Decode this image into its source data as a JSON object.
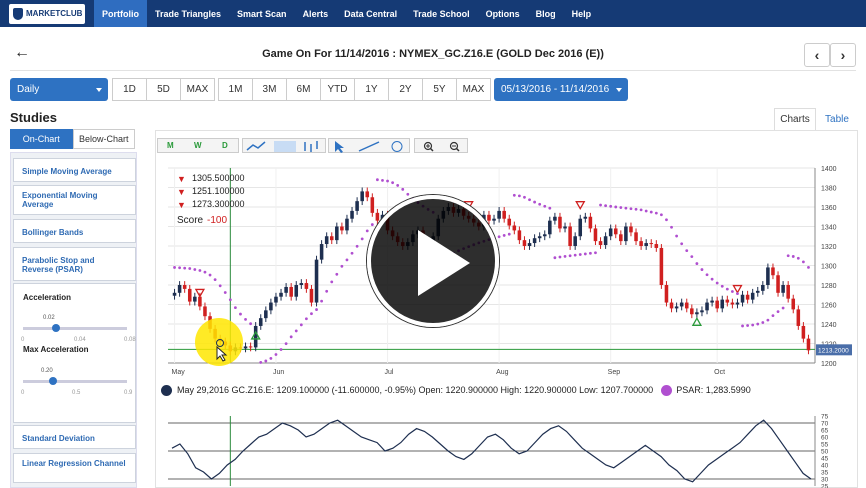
{
  "nav": {
    "logo": "MARKETCLUB",
    "items": [
      "Portfolio",
      "Trade Triangles",
      "Smart Scan",
      "Alerts",
      "Data Central",
      "Trade School",
      "Options",
      "Blog",
      "Help"
    ]
  },
  "header": {
    "back": "←",
    "title": "Game On For 11/14/2016 : NYMEX_GC.Z16.E (GOLD Dec 2016 (E))",
    "prev": "‹",
    "next": "›"
  },
  "range": {
    "interval": "Daily",
    "buttons": [
      "1D",
      "5D",
      "MAX",
      "1M",
      "3M",
      "6M",
      "YTD",
      "1Y",
      "2Y",
      "5Y",
      "MAX"
    ],
    "dates": "05/13/2016 - 11/14/2016"
  },
  "studies": {
    "heading": "Studies",
    "tabs": [
      "On-Chart",
      "Below-Chart"
    ],
    "list": [
      "Simple Moving Average",
      "Exponential Moving Average",
      "Bollinger Bands",
      "Parabolic Stop and Reverse (PSAR)",
      "Standard Deviation",
      "Linear Regression Channel"
    ],
    "psar": {
      "acceleration_label": "Acceleration",
      "acceleration_value": "0.02",
      "acceleration_ticks": [
        "0",
        "0.04",
        "0.08"
      ],
      "max_label": "Max Acceleration",
      "max_value": "0.20",
      "max_ticks": [
        "0",
        "0.5",
        "0.9"
      ]
    }
  },
  "view_tabs": [
    "Charts",
    "Table"
  ],
  "toolbar_icons": [
    "M",
    "W",
    "D"
  ],
  "legend": {
    "t1": "1305.500000",
    "t2": "1251.100000",
    "t3": "1273.300000",
    "score_label": "Score",
    "score_value": "-100"
  },
  "status_line": "May 29,2016 GC.Z16.E: 1209.100000 (-11.600000, -0.95%) Open: 1220.900000 High: 1220.900000 Low: 1207.700000",
  "psar_line": "PSAR: 1,283.5990",
  "colors": {
    "nav": "#153a75",
    "accent": "#2e72c2",
    "up": "#1e2f50",
    "down": "#d02020",
    "psar": "#b04fd0"
  },
  "chart_data": {
    "type": "candlestick",
    "x_ticks": [
      "May",
      "Jun",
      "Jul",
      "Aug",
      "Sep",
      "Oct"
    ],
    "y_ticks": [
      1200,
      1220,
      1240,
      1260,
      1280,
      1300,
      1320,
      1340,
      1360,
      1380,
      1400
    ],
    "ylim": [
      1200,
      1400
    ],
    "current_price_label": "1213.2000",
    "close": [
      1272,
      1280,
      1276,
      1263,
      1268,
      1258,
      1248,
      1235,
      1225,
      1222,
      1218,
      1212,
      1216,
      1215,
      1217,
      1216,
      1238,
      1246,
      1254,
      1262,
      1268,
      1272,
      1278,
      1268,
      1280,
      1282,
      1276,
      1262,
      1306,
      1322,
      1330,
      1326,
      1340,
      1336,
      1348,
      1356,
      1366,
      1376,
      1370,
      1354,
      1346,
      1352,
      1336,
      1330,
      1324,
      1320,
      1324,
      1332,
      1336,
      1326,
      1322,
      1330,
      1348,
      1356,
      1360,
      1354,
      1358,
      1351,
      1348,
      1344,
      1340,
      1352,
      1346,
      1348,
      1356,
      1348,
      1341,
      1336,
      1326,
      1320,
      1323,
      1328,
      1330,
      1332,
      1346,
      1350,
      1338,
      1340,
      1320,
      1330,
      1348,
      1350,
      1338,
      1325,
      1321,
      1330,
      1338,
      1332,
      1325,
      1340,
      1334,
      1325,
      1320,
      1323,
      1322,
      1318,
      1280,
      1262,
      1256,
      1258,
      1262,
      1256,
      1250,
      1252,
      1254,
      1262,
      1264,
      1256,
      1265,
      1262,
      1260,
      1262,
      1270,
      1265,
      1272,
      1274,
      1280,
      1298,
      1290,
      1272,
      1280,
      1266,
      1255,
      1238,
      1225,
      1213
    ],
    "oscillator": {
      "y_ticks": [
        25,
        30,
        35,
        40,
        45,
        50,
        55,
        60,
        65,
        70,
        75
      ],
      "ylim": [
        25,
        75
      ],
      "values": [
        52,
        55,
        48,
        38,
        35,
        30,
        34,
        40,
        44,
        50,
        55,
        60,
        62,
        66,
        70,
        68,
        65,
        60,
        62,
        66,
        70,
        72,
        68,
        64,
        60,
        58,
        56,
        50,
        52,
        56,
        62,
        66,
        64,
        60,
        55,
        50,
        46,
        44,
        48,
        54,
        60,
        62,
        58,
        52,
        48,
        50,
        56,
        62,
        66,
        68,
        64,
        58,
        52,
        48,
        44,
        40,
        38,
        42,
        46,
        50,
        54,
        50,
        46,
        40,
        36,
        30,
        28,
        34,
        40,
        44,
        48,
        52,
        56,
        62,
        68,
        72,
        66,
        58,
        50,
        42,
        34,
        30
      ]
    }
  }
}
